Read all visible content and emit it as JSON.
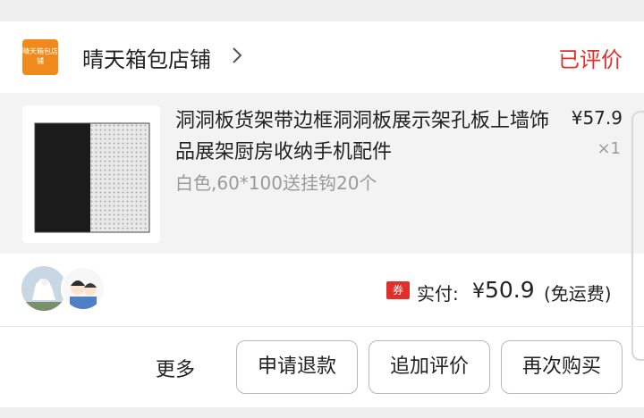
{
  "shop": {
    "logo_text": "晴天箱包店铺",
    "name": "晴天箱包店铺",
    "status": "已评价"
  },
  "item": {
    "title": "洞洞板货架带边框洞洞板展示架孔板上墙饰品展架厨房收纳手机配件",
    "spec": "白色,60*100送挂钩20个",
    "price": "¥57.9",
    "quantity": "×1"
  },
  "payment": {
    "coupon_badge": "券",
    "label": "实付:",
    "currency": "¥",
    "amount": "50.9",
    "shipping": "(免运费)"
  },
  "actions": {
    "more": "更多",
    "refund": "申请退款",
    "add_review": "追加评价",
    "rebuy": "再次购买"
  },
  "colors": {
    "accent_red": "#e0302b",
    "shop_logo": "#f08a1c",
    "item_bg": "#f3f3f3"
  }
}
